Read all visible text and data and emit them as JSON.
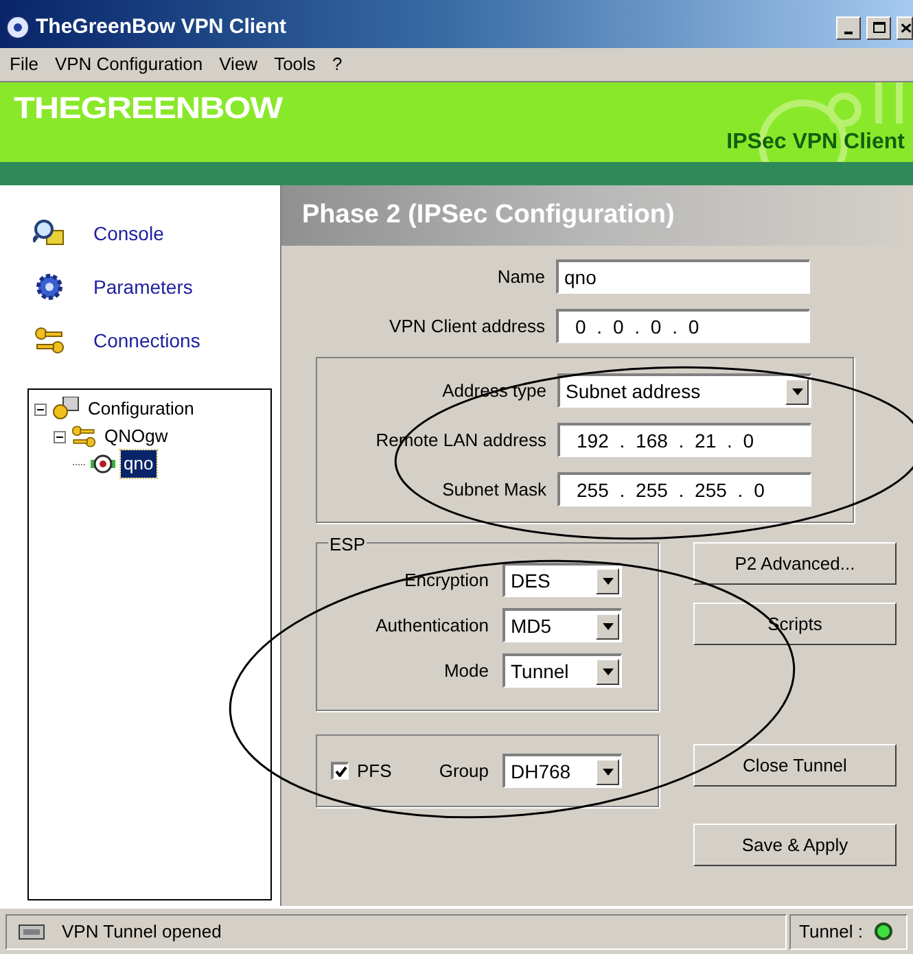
{
  "window": {
    "title": "TheGreenBow VPN Client"
  },
  "menu": [
    "File",
    "VPN Configuration",
    "View",
    "Tools",
    "?"
  ],
  "banner": {
    "brand": "THEGREENBOW",
    "product": "IPSec VPN Client"
  },
  "sidebar": {
    "items": [
      {
        "label": "Console",
        "kind": "console"
      },
      {
        "label": "Parameters",
        "kind": "parameters"
      },
      {
        "label": "Connections",
        "kind": "connections"
      }
    ]
  },
  "tree": [
    {
      "label": "Configuration",
      "kind": "root",
      "expanded": true,
      "selected": false,
      "children": [
        {
          "label": "QNOgw",
          "kind": "gateway",
          "expanded": true,
          "selected": false,
          "children": [
            {
              "label": "qno",
              "kind": "tunnel",
              "selected": true
            }
          ]
        }
      ]
    }
  ],
  "panel": {
    "title": "Phase 2 (IPSec Configuration)",
    "fields": [
      {
        "kind": "text",
        "label": "Name",
        "value": "qno"
      },
      {
        "kind": "ip",
        "label": "VPN Client address",
        "value": "0 . 0 . 0 . 0"
      }
    ],
    "remote": [
      {
        "kind": "select",
        "label": "Address type",
        "value": "Subnet address"
      },
      {
        "kind": "ip",
        "label": "Remote LAN address",
        "value": "192 . 168 . 21 . 0"
      },
      {
        "kind": "ip",
        "label": "Subnet Mask",
        "value": "255 . 255 . 255 . 0"
      }
    ],
    "esp": {
      "title": "ESP",
      "fields": [
        {
          "kind": "select",
          "label": "Encryption",
          "value": "DES"
        },
        {
          "kind": "select",
          "label": "Authentication",
          "value": "MD5"
        },
        {
          "kind": "select",
          "label": "Mode",
          "value": "Tunnel"
        }
      ]
    },
    "pfs": {
      "label": "PFS",
      "checked": true,
      "group_label": "Group",
      "group": "DH768"
    },
    "buttons": [
      "P2 Advanced...",
      "Scripts",
      "Close Tunnel",
      "Save & Apply"
    ]
  },
  "status_bar": {
    "message": "VPN Tunnel opened",
    "tunnel_label": "Tunnel :",
    "tunnel_on": true
  }
}
